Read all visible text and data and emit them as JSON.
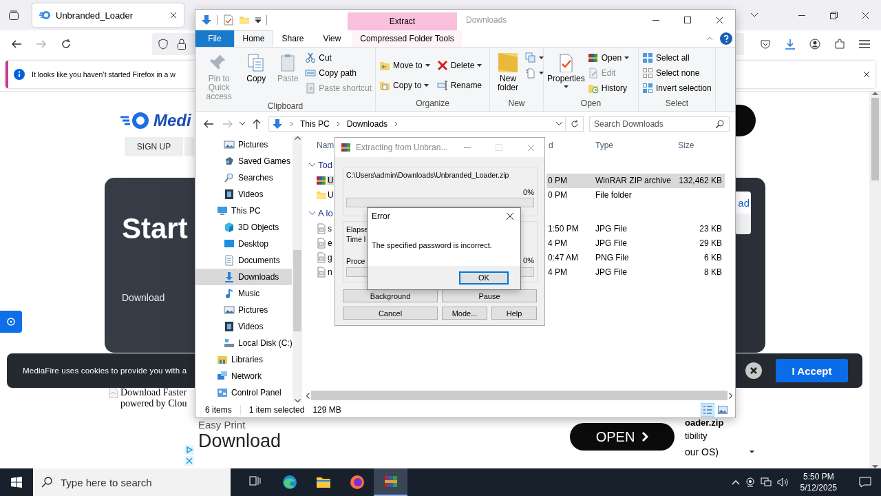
{
  "browser": {
    "tab": {
      "title": "Unbranded_Loader",
      "selected": true
    },
    "nav_buttons": [
      {
        "disabled": false
      },
      {
        "disabled": true
      },
      {
        "disabled": false
      }
    ],
    "notification": "It looks like you haven’t started Firefox in a w",
    "page": {
      "logo": "Medi",
      "sign_up": "SIGN UP",
      "hero_title": "Start",
      "hero_link": "Download",
      "side_button": "ad",
      "promo": [
        "Download Faster",
        "powered by Clou"
      ],
      "cookie": {
        "text": "MediaFire uses cookies to provide you with a",
        "accept": "I Accept"
      },
      "ad": {
        "eyebrow": "Easy Print",
        "title": "Download",
        "cta": "OPEN"
      },
      "file_panel": {
        "filename": "oader.zip",
        "compatibility": "tibility",
        "os_select": "our OS)"
      }
    }
  },
  "explorer": {
    "title": "Downloads",
    "context_label": "Extract",
    "tabs": [
      {
        "label": "File",
        "kind": "file",
        "selected": false
      },
      {
        "label": "Home",
        "kind": "normal",
        "selected": true
      },
      {
        "label": "Share",
        "kind": "normal",
        "selected": false
      },
      {
        "label": "View",
        "kind": "normal",
        "selected": false
      },
      {
        "label": "Compressed Folder Tools",
        "kind": "context",
        "selected": false
      }
    ],
    "ribbon": [
      {
        "label": "Clipboard",
        "items": [
          {
            "label": "Pin to Quick access",
            "kind": "large",
            "disabled": true
          },
          {
            "label": "Copy",
            "kind": "large",
            "disabled": false
          },
          {
            "label": "Paste",
            "kind": "large",
            "disabled": true
          },
          {
            "label": "Cut",
            "kind": "small",
            "disabled": false
          },
          {
            "label": "Copy path",
            "kind": "small",
            "disabled": false
          },
          {
            "label": "Paste shortcut",
            "kind": "small",
            "disabled": true
          }
        ]
      },
      {
        "label": "Organize",
        "items": [
          {
            "label": "Move to",
            "kind": "small",
            "dropdown": true,
            "disabled": false
          },
          {
            "label": "Copy to",
            "kind": "small",
            "dropdown": true,
            "disabled": false
          },
          {
            "label": "Delete",
            "kind": "small",
            "dropdown": true,
            "disabled": false
          },
          {
            "label": "Rename",
            "kind": "small",
            "disabled": false
          }
        ]
      },
      {
        "label": "New",
        "items": [
          {
            "label": "New folder",
            "kind": "large",
            "disabled": false
          },
          {
            "kind": "icon",
            "dropdown": true,
            "disabled": false
          },
          {
            "kind": "icon",
            "dropdown": true,
            "disabled": false
          }
        ]
      },
      {
        "label": "Open",
        "items": [
          {
            "label": "Properties",
            "kind": "large",
            "dropdown": true,
            "disabled": false
          },
          {
            "label": "Open",
            "kind": "small",
            "dropdown": true,
            "disabled": false
          },
          {
            "label": "Edit",
            "kind": "small",
            "disabled": true
          },
          {
            "label": "History",
            "kind": "small",
            "disabled": false
          }
        ]
      },
      {
        "label": "Select",
        "items": [
          {
            "label": "Select all",
            "kind": "small",
            "disabled": false
          },
          {
            "label": "Select none",
            "kind": "small",
            "disabled": false
          },
          {
            "label": "Invert selection",
            "kind": "small",
            "disabled": false
          }
        ]
      }
    ],
    "address": [
      "This PC",
      "Downloads"
    ],
    "search_placeholder": "Search Downloads",
    "nav": [
      {
        "children": [
          {
            "label": "Pictures",
            "selected": false
          },
          {
            "label": "Saved Games",
            "selected": false
          },
          {
            "label": "Searches",
            "selected": false
          },
          {
            "label": "Videos",
            "selected": false
          }
        ]
      },
      {
        "label": "This PC",
        "selected": false,
        "children": [
          {
            "label": "3D Objects",
            "selected": false
          },
          {
            "label": "Desktop",
            "selected": false
          },
          {
            "label": "Documents",
            "selected": false
          },
          {
            "label": "Downloads",
            "selected": true
          },
          {
            "label": "Music",
            "selected": false
          },
          {
            "label": "Pictures",
            "selected": false
          },
          {
            "label": "Videos",
            "selected": false
          },
          {
            "label": "Local Disk (C:)",
            "selected": false
          }
        ]
      },
      {
        "label": "Libraries",
        "selected": false
      },
      {
        "label": "Network",
        "selected": false
      },
      {
        "label": "Control Panel",
        "selected": false
      }
    ],
    "columns": [
      "Nam",
      "d",
      "Type",
      "Size"
    ],
    "groups": [
      {
        "label": "Tod",
        "expanded": true,
        "rows": [
          {
            "kind": "archive",
            "name": "U",
            "date": "0 PM",
            "type": "WinRAR ZIP archive",
            "size": "132,462 KB",
            "selected": true
          },
          {
            "kind": "folder",
            "name": "U",
            "date": "0 PM",
            "type": "File folder",
            "selected": false
          }
        ]
      },
      {
        "label": "A lo",
        "expanded": true,
        "rows": [
          {
            "kind": "image",
            "name": "s",
            "date": "1:50 PM",
            "type": "JPG File",
            "size": "23 KB",
            "selected": false
          },
          {
            "kind": "image",
            "name": "e",
            "date": "4 PM",
            "type": "JPG File",
            "size": "29 KB",
            "selected": false
          },
          {
            "kind": "image",
            "name": "g",
            "date": "0:47 AM",
            "type": "PNG File",
            "size": "6 KB",
            "selected": false
          },
          {
            "kind": "image",
            "name": "n",
            "date": "4 PM",
            "type": "JPG File",
            "size": "8 KB",
            "selected": false
          }
        ]
      }
    ],
    "status": [
      "6 items",
      "1 item selected",
      "129 MB"
    ],
    "views": [
      {
        "selected": true
      },
      {
        "selected": false
      }
    ]
  },
  "winrar": {
    "title": "Extracting from Unbran...",
    "path": "C:\\Users\\admin\\Downloads\\Unbranded_Loader.zip",
    "progress": {
      "reading": "0%",
      "level": 0
    },
    "labels": [
      "Elapse",
      "Time l"
    ],
    "process": {
      "label": "Proce",
      "reading": "0%",
      "level": 0
    },
    "buttons": [
      "Background",
      "Pause",
      "Cancel",
      "Mode...",
      "Help"
    ]
  },
  "error": {
    "title": "Error",
    "message": "The specified password is incorrect.",
    "ok": "OK"
  },
  "taskbar": {
    "search_placeholder": "Type here to search",
    "apps": [
      {
        "selected": false
      },
      {
        "selected": false
      },
      {
        "selected": false
      },
      {
        "selected": false
      },
      {
        "selected": true
      }
    ],
    "time": "5:50 PM",
    "date": "5/12/2025"
  }
}
